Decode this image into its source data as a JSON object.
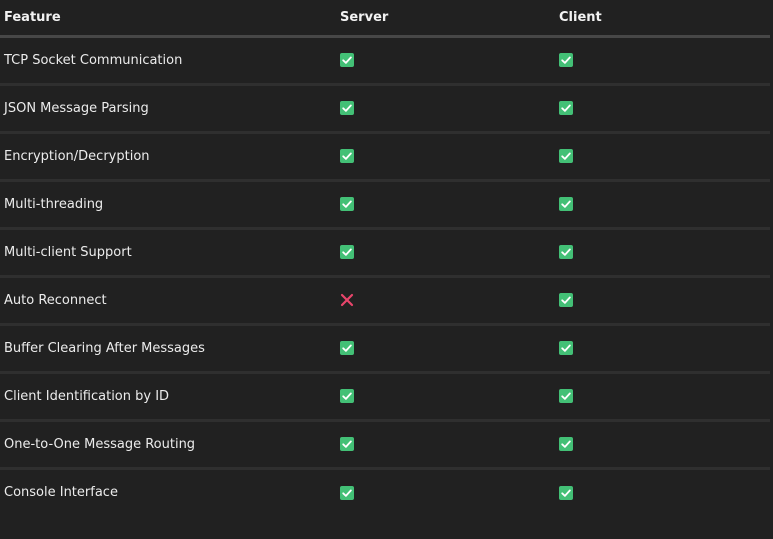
{
  "table": {
    "headers": [
      "Feature",
      "Server",
      "Client"
    ],
    "rows": [
      {
        "feature": "TCP Socket Communication",
        "server": "check",
        "client": "check"
      },
      {
        "feature": "JSON Message Parsing",
        "server": "check",
        "client": "check"
      },
      {
        "feature": "Encryption/Decryption",
        "server": "check",
        "client": "check"
      },
      {
        "feature": "Multi-threading",
        "server": "check",
        "client": "check"
      },
      {
        "feature": "Multi-client Support",
        "server": "check",
        "client": "check"
      },
      {
        "feature": "Auto Reconnect",
        "server": "cross",
        "client": "check"
      },
      {
        "feature": "Buffer Clearing After Messages",
        "server": "check",
        "client": "check"
      },
      {
        "feature": "Client Identification by ID",
        "server": "check",
        "client": "check"
      },
      {
        "feature": "One-to-One Message Routing",
        "server": "check",
        "client": "check"
      },
      {
        "feature": "Console Interface",
        "server": "check",
        "client": "check"
      }
    ]
  },
  "icons": {
    "check": "check-mark-button-icon",
    "cross": "cross-mark-icon"
  },
  "colors": {
    "background": "#212121",
    "check_bg": "#43c076",
    "cross": "#e8456b",
    "header_rule": "#474747",
    "row_rule": "#2f2f2f"
  }
}
